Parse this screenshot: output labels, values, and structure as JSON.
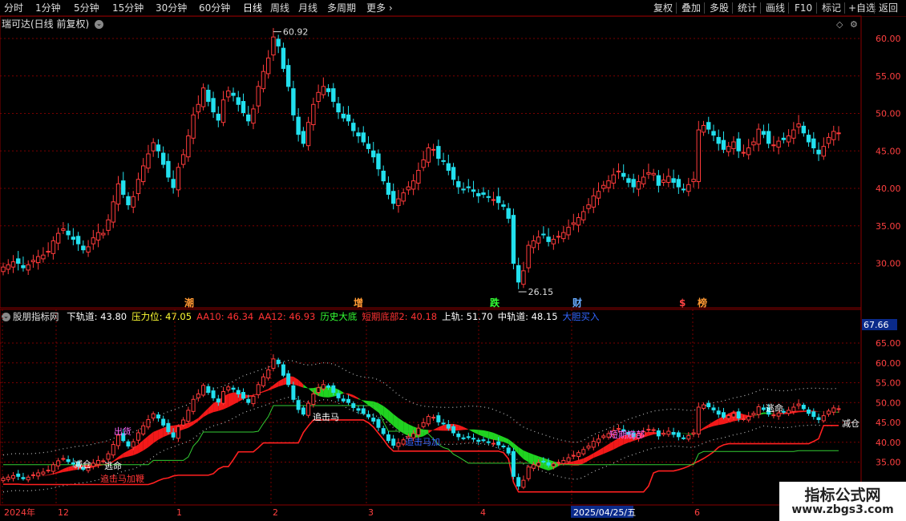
{
  "toolbar": {
    "timeframes": [
      "分时",
      "1分钟",
      "5分钟",
      "15分钟",
      "30分钟",
      "60分钟",
      "日线",
      "周线",
      "月线",
      "多周期",
      "更多"
    ],
    "active": "日线",
    "tools": [
      "复权",
      "叠加",
      "多股",
      "统计",
      "画线",
      "F10",
      "标记",
      "+自选",
      "返回"
    ]
  },
  "stock": {
    "title": "瑞可达(日线 前复权)"
  },
  "price_axis": [
    "60.00",
    "55.00",
    "50.00",
    "45.00",
    "40.00",
    "35.00",
    "30.00"
  ],
  "annotations": {
    "high": "60.92",
    "low": "26.15"
  },
  "event_marks": [
    "潮",
    "增",
    "跌",
    "财",
    "$",
    "榜"
  ],
  "indicator": {
    "name": "股朋指标网",
    "fields": [
      {
        "label": "下轨道:",
        "value": "43.80",
        "color": "#ffffff"
      },
      {
        "label": "压力位:",
        "value": "47.05",
        "color": "#ffff33"
      },
      {
        "label": "AA10:",
        "value": "46.34",
        "color": "#ff3333"
      },
      {
        "label": "AA12:",
        "value": "46.93",
        "color": "#ff3333"
      },
      {
        "label": "历史大底",
        "value": "",
        "color": "#33ff33"
      },
      {
        "label": "短期底部2:",
        "value": "40.18",
        "color": "#ff3333"
      },
      {
        "label": "上轨:",
        "value": "51.70",
        "color": "#ffffff"
      },
      {
        "label": "中轨道:",
        "value": "48.15",
        "color": "#ffffff"
      },
      {
        "label": "大胆买入",
        "value": "",
        "color": "#3366ff"
      }
    ],
    "axis": [
      "65.00",
      "60.00",
      "55.00",
      "50.00",
      "45.00",
      "40.00",
      "35.00"
    ],
    "current_value": "67.66",
    "signals": [
      "减仓",
      "逃命",
      "出货",
      "追击马加鞭",
      "追击马",
      "追击马加",
      "短期底部",
      "逃命",
      "减仓"
    ]
  },
  "date_axis": [
    "2024年",
    "12",
    "1",
    "2",
    "3",
    "4",
    "2025/04/25/五",
    "6"
  ],
  "watermark": {
    "line1": "指标公式网",
    "line2": "www.zbgs3.com"
  },
  "colors": {
    "up": "#ff3b3b",
    "down": "#22e0ee",
    "grid": "#7a0000",
    "red_band": "#ff1a1a",
    "green_band": "#22dd22"
  }
}
